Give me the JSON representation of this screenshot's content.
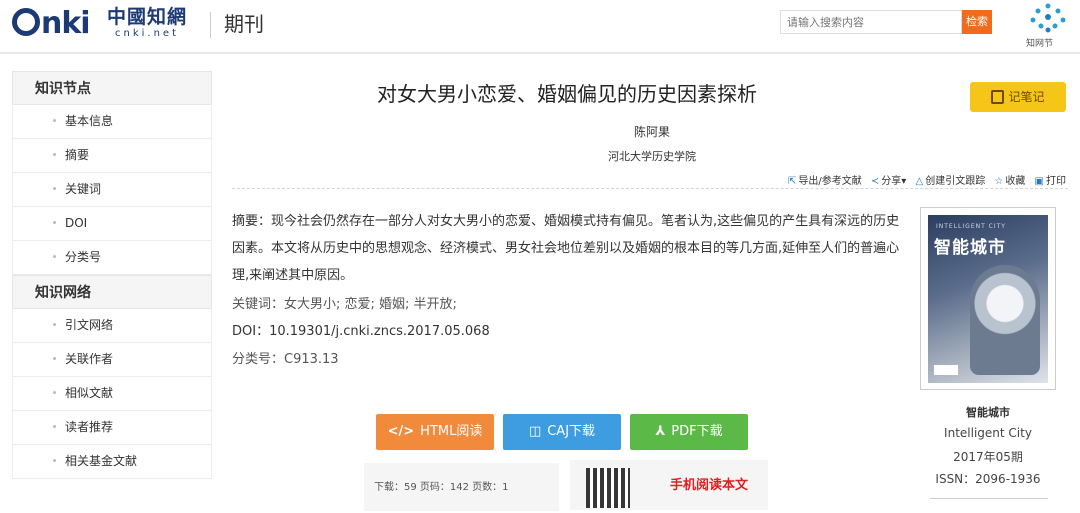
{
  "header": {
    "logo_main": "nki",
    "logo_cn": "中國知網",
    "logo_net": "cnki.net",
    "section": "期刊",
    "search_placeholder": "请输入搜索内容",
    "search_button": "检索",
    "zhiwang_label": "知网节",
    "accent_color": "#f26b1d"
  },
  "sidebar": {
    "group1_title": "知识节点",
    "group1_items": [
      "基本信息",
      "摘要",
      "关键词",
      "DOI",
      "分类号"
    ],
    "group2_title": "知识网络",
    "group2_items": [
      "引文网络",
      "关联作者",
      "相似文献",
      "读者推荐",
      "相关基金文献"
    ]
  },
  "article": {
    "title": "对女大男小恋爱、婚姻偏见的历史因素探析",
    "note_button": "记笔记",
    "author": "陈阿果",
    "organization": "河北大学历史学院",
    "tools": {
      "export": "导出/参考文献",
      "share": "分享",
      "track": "创建引文跟踪",
      "favorite": "收藏",
      "print": "打印"
    },
    "abstract": "摘要：现今社会仍然存在一部分人对女大男小的恋爱、婚姻模式持有偏见。笔者认为,这些偏见的产生具有深远的历史因素。本文将从历史中的思想观念、经济模式、男女社会地位差别以及婚姻的根本目的等几方面,延伸至人们的普遍心理,来阐述其中原因。",
    "keywords": "关键词：女大男小; 恋爱; 婚姻; 半开放;",
    "doi": "DOI：10.19301/j.cnki.zncs.2017.05.068",
    "classification": "分类号：C913.13"
  },
  "actions": {
    "html_read": "HTML阅读",
    "caj_download": "CAJ下载",
    "pdf_download": "PDF下载",
    "stats": "下载：59   页码：142   页数：1",
    "mobile_read": "手机阅读本文"
  },
  "journal": {
    "cover_title": "智能城市",
    "cover_en": "INTELLIGENT CITY",
    "name": "智能城市",
    "name_en": "Intelligent City",
    "issue": "2017年05期",
    "issn": "ISSN：2096-1936"
  }
}
